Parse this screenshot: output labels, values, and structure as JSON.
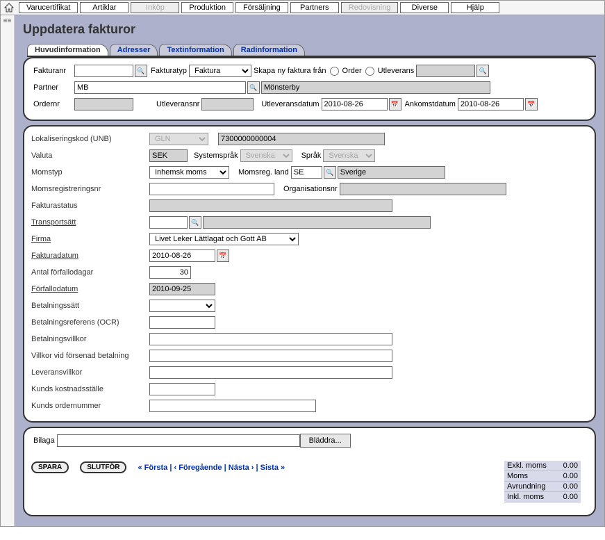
{
  "menu": {
    "items": [
      {
        "label": "Varucertifikat",
        "disabled": false
      },
      {
        "label": "Artiklar",
        "disabled": false
      },
      {
        "label": "Inköp",
        "disabled": true
      },
      {
        "label": "Produktion",
        "disabled": false
      },
      {
        "label": "Försäljning",
        "disabled": false
      },
      {
        "label": "Partners",
        "disabled": false
      },
      {
        "label": "Redovisning",
        "disabled": true
      },
      {
        "label": "Diverse",
        "disabled": false
      },
      {
        "label": "Hjälp",
        "disabled": false
      }
    ]
  },
  "page_title": "Uppdatera fakturor",
  "tabs": [
    {
      "label": "Huvudinformation",
      "active": true
    },
    {
      "label": "Adresser",
      "active": false
    },
    {
      "label": "Textinformation",
      "active": false
    },
    {
      "label": "Radinformation",
      "active": false
    }
  ],
  "header": {
    "fakturanr_label": "Fakturanr",
    "fakturanr_value": "",
    "fakturatyp_label": "Fakturatyp",
    "fakturatyp_value": "Faktura",
    "skapa_ny_label": "Skapa ny faktura från",
    "order_label": "Order",
    "utleverans_label": "Utleverans",
    "utleverans_value": "",
    "partner_label": "Partner",
    "partner_code": "MB",
    "partner_name": "Mönsterby",
    "ordernr_label": "Ordernr",
    "ordernr_value": "",
    "utleveransnr_label": "Utleveransnr",
    "utleveransnr_value": "",
    "utleveransdatum_label": "Utleveransdatum",
    "utleveransdatum_value": "2010-08-26",
    "ankomstdatum_label": "Ankomstdatum",
    "ankomstdatum_value": "2010-08-26"
  },
  "fields": {
    "lokaliseringskod_label": "Lokaliseringskod (UNB)",
    "lokaliseringskod_type": "GLN",
    "lokaliseringskod_value": "7300000000004",
    "valuta_label": "Valuta",
    "valuta_value": "SEK",
    "systemsprak_label": "Systemspråk",
    "systemsprak_value": "Svenska",
    "sprak_label": "Språk",
    "sprak_value": "Svenska",
    "momstyp_label": "Momstyp",
    "momstyp_value": "Inhemsk moms",
    "momsregland_label": "Momsreg. land",
    "momsregland_code": "SE",
    "momsregland_name": "Sverige",
    "momsregnr_label": "Momsregistreringsnr",
    "momsregnr_value": "",
    "organisationsnr_label": "Organisationsnr",
    "organisationsnr_value": "",
    "fakturastatus_label": "Fakturastatus",
    "fakturastatus_value": "",
    "transportsatt_label": "Transportsätt",
    "transportsatt_code": "",
    "transportsatt_name": "",
    "firma_label": "Firma",
    "firma_value": "Livet Leker Lättlagat och Gott AB",
    "fakturadatum_label": "Fakturadatum",
    "fakturadatum_value": "2010-08-26",
    "antal_forfallodagar_label": "Antal förfallodagar",
    "antal_forfallodagar_value": "30",
    "forfallodatum_label": "Förfallodatum",
    "forfallodatum_value": "2010-09-25",
    "betalningssatt_label": "Betalningssätt",
    "betalningssatt_value": "",
    "betalningsreferens_label": "Betalningsreferens (OCR)",
    "betalningsreferens_value": "",
    "betalningsvillkor_label": "Betalningsvillkor",
    "betalningsvillkor_value": "",
    "villkor_forsenad_label": "Villkor vid försenad betalning",
    "villkor_forsenad_value": "",
    "leveransvillkor_label": "Leveransvillkor",
    "leveransvillkor_value": "",
    "kunds_kostnadsstalle_label": "Kunds kostnadsställe",
    "kunds_kostnadsstalle_value": "",
    "kunds_ordernummer_label": "Kunds ordernummer",
    "kunds_ordernummer_value": ""
  },
  "footer": {
    "bilaga_label": "Bilaga",
    "bilaga_value": "",
    "browse_label": "Bläddra...",
    "spara_label": "SPARA",
    "slutfor_label": "SLUTFÖR",
    "nav_first": "« Första",
    "nav_prev": "‹ Föregående",
    "nav_next": "Nästa ›",
    "nav_last": "Sista »",
    "totals": {
      "exkl_label": "Exkl. moms",
      "exkl_val": "0.00",
      "moms_label": "Moms",
      "moms_val": "0.00",
      "avrundning_label": "Avrundning",
      "avrundning_val": "0.00",
      "inkl_label": "Inkl. moms",
      "inkl_val": "0.00"
    }
  }
}
